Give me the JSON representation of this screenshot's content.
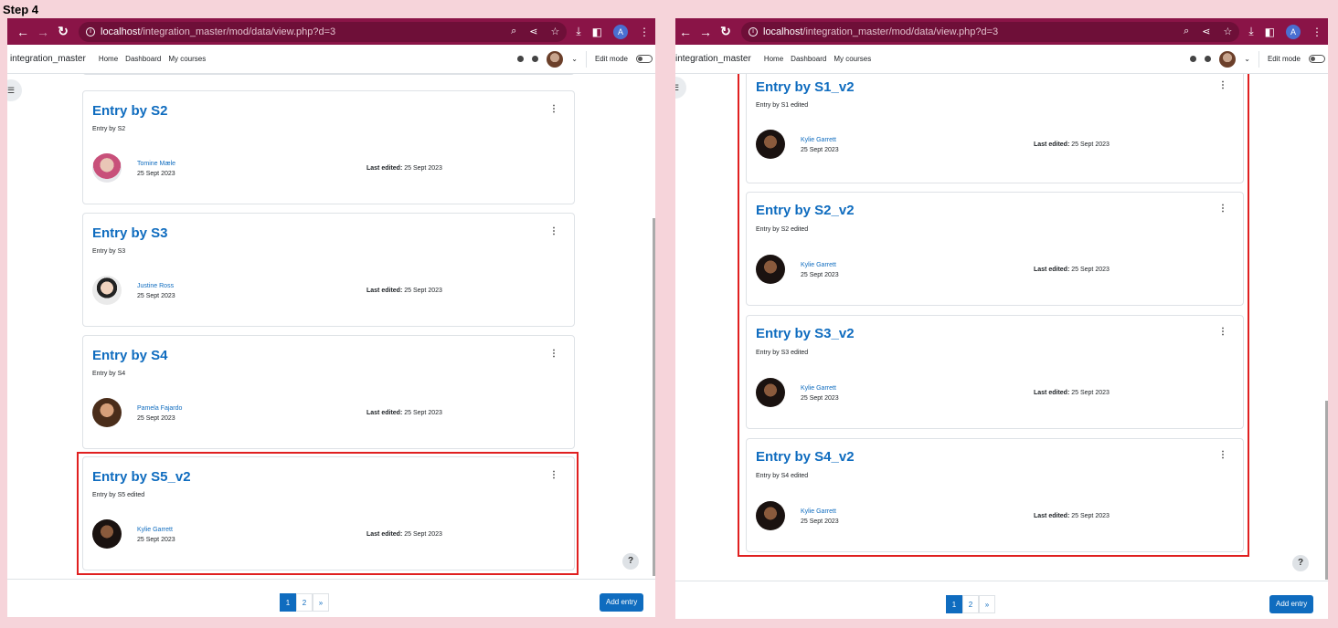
{
  "step_label": "Step 4",
  "browser": {
    "url_host": "localhost",
    "url_path": "/integration_master/mod/data/view.php?d=3",
    "profile_initial": "A"
  },
  "navbar": {
    "brand": "integration_master",
    "links": [
      "Home",
      "Dashboard",
      "My courses"
    ],
    "edit_mode_label": "Edit mode"
  },
  "left_entries": [
    {
      "title": "Entry by S2",
      "description": "Entry by S2",
      "author": "Tomine Mæle",
      "date": "25 Sept 2023",
      "last_edited_label": "Last edited:",
      "last_edited": "25 Sept 2023"
    },
    {
      "title": "Entry by S3",
      "description": "Entry by S3",
      "author": "Justine Ross",
      "date": "25 Sept 2023",
      "last_edited_label": "Last edited:",
      "last_edited": "25 Sept 2023"
    },
    {
      "title": "Entry by S4",
      "description": "Entry by S4",
      "author": "Pamela Fajardo",
      "date": "25 Sept 2023",
      "last_edited_label": "Last edited:",
      "last_edited": "25 Sept 2023"
    },
    {
      "title": "Entry by S5_v2",
      "description": "Entry by S5 edited",
      "author": "Kylie Garrett",
      "date": "25 Sept 2023",
      "last_edited_label": "Last edited:",
      "last_edited": "25 Sept 2023"
    }
  ],
  "right_entries": [
    {
      "title": "Entry by S1_v2",
      "description": "Entry by S1 edited",
      "author": "Kylie Garrett",
      "date": "25 Sept 2023",
      "last_edited_label": "Last edited:",
      "last_edited": "25 Sept 2023"
    },
    {
      "title": "Entry by S2_v2",
      "description": "Entry by S2 edited",
      "author": "Kylie Garrett",
      "date": "25 Sept 2023",
      "last_edited_label": "Last edited:",
      "last_edited": "25 Sept 2023"
    },
    {
      "title": "Entry by S3_v2",
      "description": "Entry by S3 edited",
      "author": "Kylie Garrett",
      "date": "25 Sept 2023",
      "last_edited_label": "Last edited:",
      "last_edited": "25 Sept 2023"
    },
    {
      "title": "Entry by S4_v2",
      "description": "Entry by S4 edited",
      "author": "Kylie Garrett",
      "date": "25 Sept 2023",
      "last_edited_label": "Last edited:",
      "last_edited": "25 Sept 2023"
    }
  ],
  "pagination": {
    "pages": [
      "1",
      "2"
    ],
    "next": "»",
    "active": "1"
  },
  "add_entry_label": "Add entry",
  "help_label": "?"
}
